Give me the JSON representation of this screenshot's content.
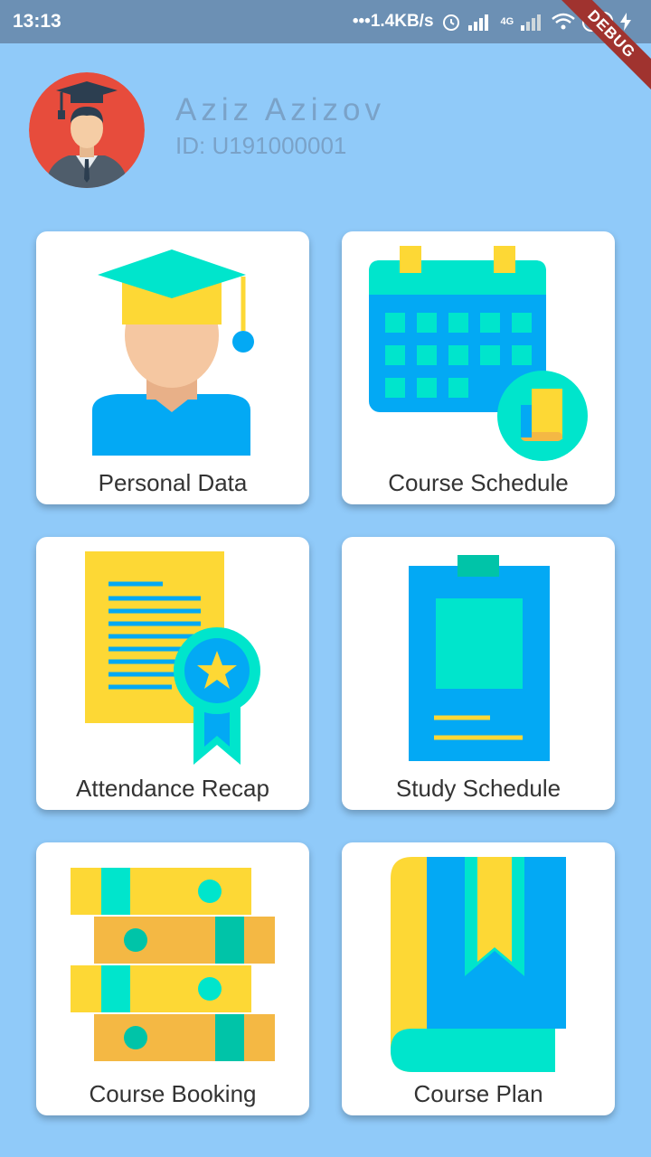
{
  "status_bar": {
    "time": "13:13",
    "net_speed": "•••1.4KB/s",
    "network_label": "4G",
    "battery": "22",
    "icons": [
      "alarm-icon",
      "signal-icon",
      "signal-4g-icon",
      "wifi-icon",
      "battery-icon",
      "charging-icon"
    ]
  },
  "debug_banner": "DEBUG",
  "profile": {
    "name": "Aziz Azizov",
    "id_text": "ID: U191000001"
  },
  "menu": [
    {
      "label": "Personal Data",
      "icon": "graduate-icon"
    },
    {
      "label": "Course Schedule",
      "icon": "calendar-icon"
    },
    {
      "label": "Attendance Recap",
      "icon": "certificate-icon"
    },
    {
      "label": "Study Schedule",
      "icon": "clipboard-icon"
    },
    {
      "label": "Course Booking",
      "icon": "books-icon"
    },
    {
      "label": "Course Plan",
      "icon": "bookmark-book-icon"
    }
  ],
  "colors": {
    "background": "#90caf9",
    "status_bar": "#6c90b4",
    "teal": "#00e5cc",
    "blue": "#03a9f4",
    "yellow": "#fdd835",
    "text_profile": "#7aa2c8"
  }
}
